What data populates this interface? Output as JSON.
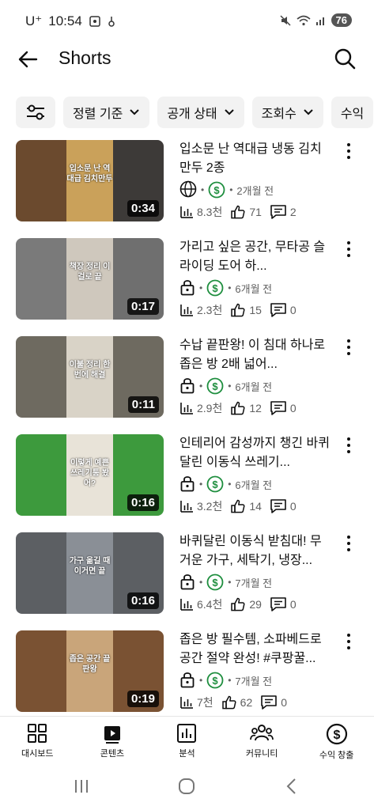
{
  "status": {
    "carrier": "U⁺",
    "time": "10:54",
    "battery": "76"
  },
  "header": {
    "title": "Shorts"
  },
  "chips": [
    {
      "label": "정렬 기준"
    },
    {
      "label": "공개 상태"
    },
    {
      "label": "조회수"
    },
    {
      "label": "수익"
    }
  ],
  "videos": [
    {
      "title": "입소문 난 역대급 냉동 김치만두 2종",
      "visibility_icon": "globe-icon",
      "age": "2개월 전",
      "views": "8.3천",
      "likes": "71",
      "comments": "2",
      "duration": "0:34",
      "caption": "입소문 난 역대급 김치만두",
      "thumb_colors": [
        "#6b4a2e",
        "#caa15a",
        "#3d3a38"
      ]
    },
    {
      "title": "가리고 싶은 공간, 무타공 슬라이딩 도어 하...",
      "visibility_icon": "lock-icon",
      "age": "6개월 전",
      "views": "2.3천",
      "likes": "15",
      "comments": "0",
      "duration": "0:17",
      "caption": "책장 정리 이걸로 끝",
      "thumb_colors": [
        "#7a7a7a",
        "#cfc8bd",
        "#6f6f6f"
      ]
    },
    {
      "title": "수납 끝판왕! 이 침대 하나로 좁은 방 2배 넓어...",
      "visibility_icon": "lock-icon",
      "age": "6개월 전",
      "views": "2.9천",
      "likes": "12",
      "comments": "0",
      "duration": "0:11",
      "caption": "이불 정리 한번에 해결",
      "thumb_colors": [
        "#6e6a60",
        "#d9d3c7",
        "#6e6a60"
      ]
    },
    {
      "title": "인테리어 감성까지 챙긴 바퀴 달린 이동식 쓰레기...",
      "visibility_icon": "lock-icon",
      "age": "6개월 전",
      "views": "3.2천",
      "likes": "14",
      "comments": "0",
      "duration": "0:16",
      "caption": "이렇게 예쁜 쓰레기통 봤어?",
      "thumb_colors": [
        "#3d9a3d",
        "#e8e3d8",
        "#3d9a3d"
      ]
    },
    {
      "title": "바퀴달린 이동식 받침대! 무거운 가구, 세탁기, 냉장...",
      "visibility_icon": "lock-icon",
      "age": "7개월 전",
      "views": "6.4천",
      "likes": "29",
      "comments": "0",
      "duration": "0:16",
      "caption": "가구 옮길 때 이거면 끝",
      "thumb_colors": [
        "#5c5f63",
        "#8a8f96",
        "#5c5f63"
      ]
    },
    {
      "title": "좁은 방 필수템, 소파베드로 공간 절약 완성! #쿠팡꿀...",
      "visibility_icon": "lock-icon",
      "age": "7개월 전",
      "views": "7천",
      "likes": "62",
      "comments": "0",
      "duration": "0:19",
      "caption": "좁은 공간 끝판왕",
      "thumb_colors": [
        "#7a5233",
        "#c9a57a",
        "#7a5233"
      ]
    }
  ],
  "bottom_nav": [
    {
      "label": "대시보드",
      "icon": "dashboard-icon"
    },
    {
      "label": "콘텐츠",
      "icon": "content-icon"
    },
    {
      "label": "분석",
      "icon": "analytics-icon"
    },
    {
      "label": "커뮤니티",
      "icon": "community-icon"
    },
    {
      "label": "수익 창출",
      "icon": "earn-icon"
    }
  ],
  "colors": {
    "monetized_green": "#1e8e3e",
    "chip_bg": "#f2f2f2"
  }
}
